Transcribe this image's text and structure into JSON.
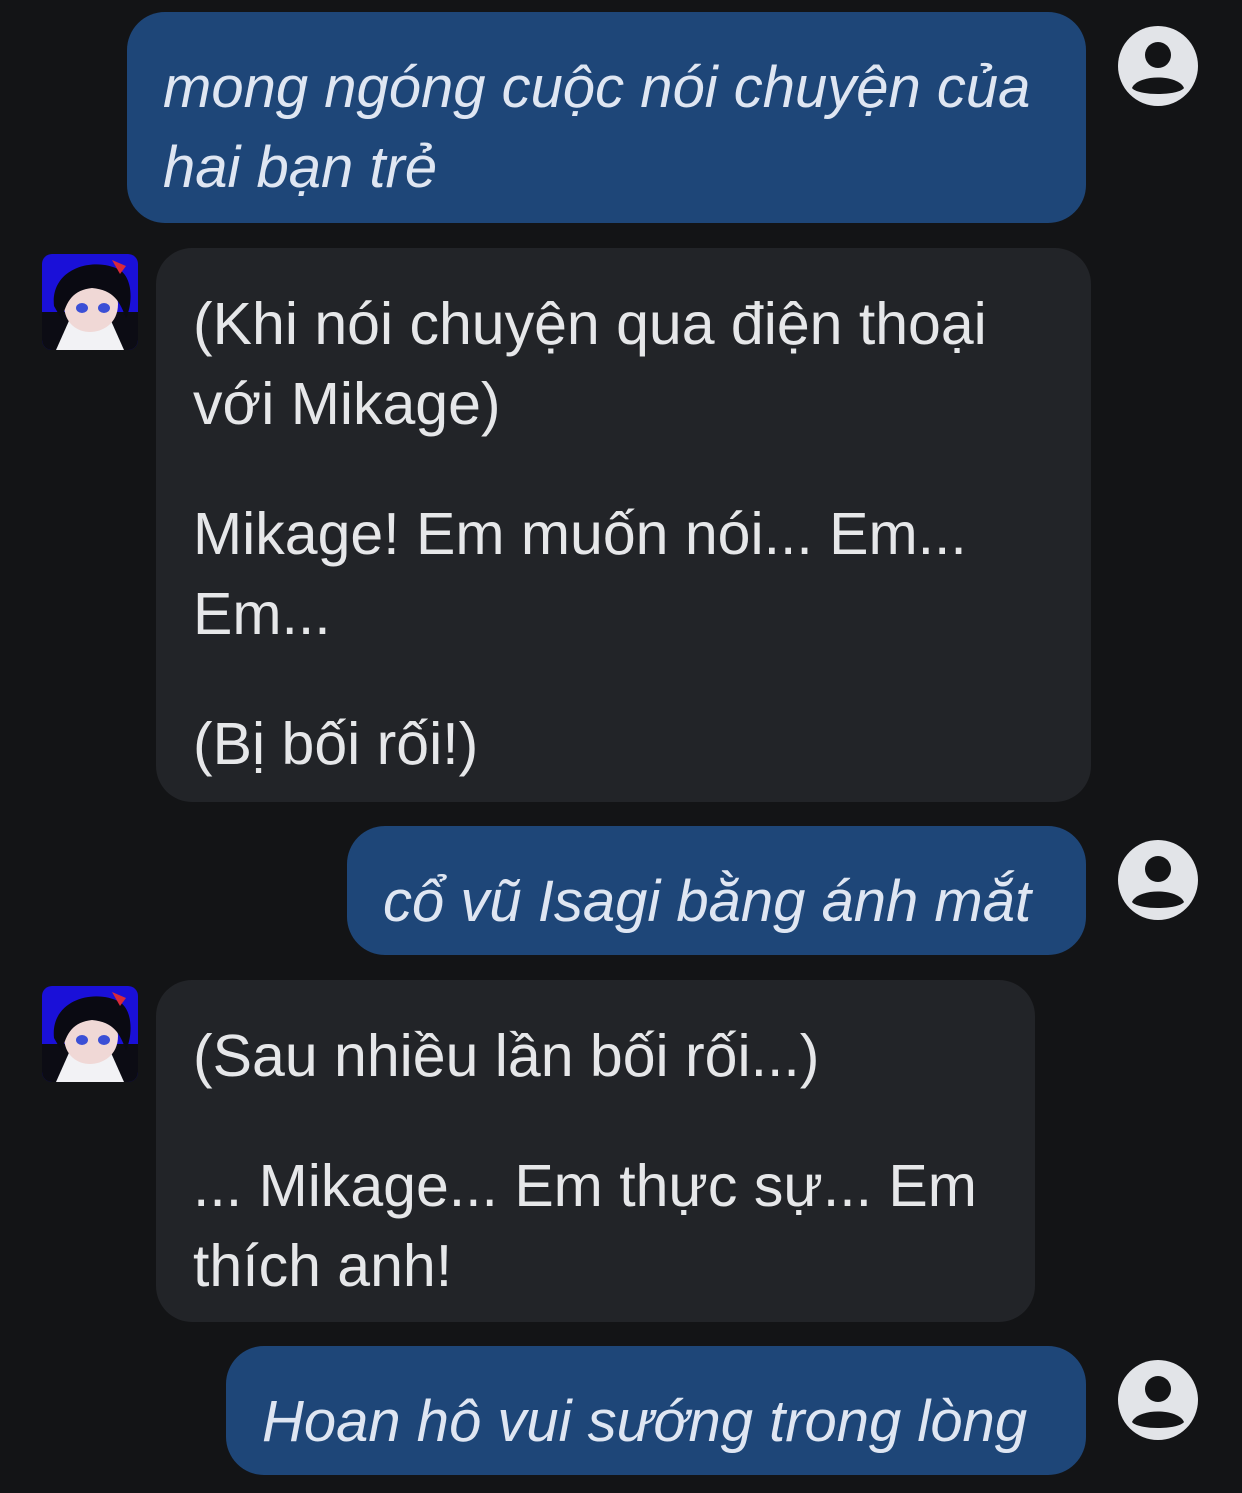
{
  "messages": [
    {
      "role": "user",
      "text_lines": [
        "mong ngóng cuộc nói chuyện của",
        "hai bạn trẻ"
      ],
      "avatar_icon": "user-circle-icon"
    },
    {
      "role": "bot",
      "paragraphs": [
        "(Khi nói chuyện qua điện thoại với Mikage)",
        "Mikage! Em muốn nói... Em... Em...",
        "(Bị bối rối!)"
      ],
      "avatar_icon": "character-avatar"
    },
    {
      "role": "user",
      "text_lines": [
        "cổ vũ Isagi bằng ánh mắt"
      ],
      "avatar_icon": "user-circle-icon"
    },
    {
      "role": "bot",
      "paragraphs": [
        "(Sau nhiều lần bối rối...)",
        "... Mikage... Em thực sự... Em thích anh!"
      ],
      "avatar_icon": "character-avatar"
    },
    {
      "role": "user",
      "text_lines": [
        "Hoan hô vui sướng trong lòng"
      ],
      "avatar_icon": "user-circle-icon"
    }
  ],
  "colors": {
    "background": "#131416",
    "user_bubble": "#1e4678",
    "bot_bubble": "#222428",
    "user_icon": "#e2e4e8"
  }
}
